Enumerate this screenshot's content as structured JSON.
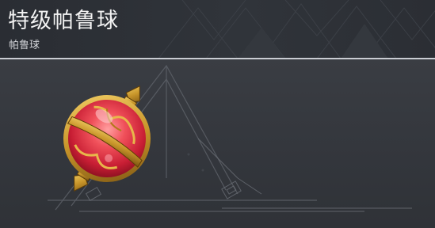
{
  "item": {
    "name": "特级帕鲁球",
    "category": "帕鲁球",
    "image_icon": "ultra-pal-sphere-icon"
  },
  "colors": {
    "header_bg": "#2e3137",
    "panel_bg": "#363940",
    "divider": "#c9ccd2",
    "sphere_red": "#e8404a",
    "sphere_gold": "#c8952a"
  }
}
